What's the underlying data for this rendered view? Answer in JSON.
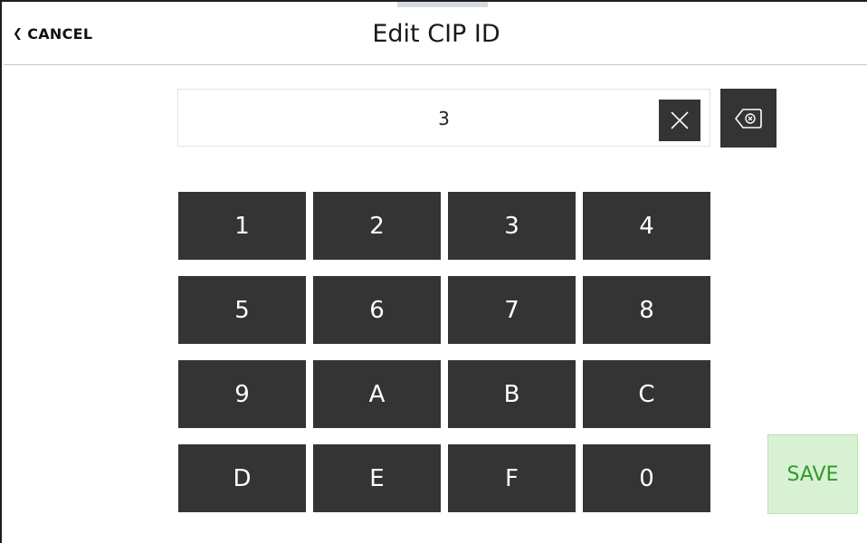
{
  "header": {
    "cancel_label": "CANCEL",
    "title": "Edit CIP ID"
  },
  "entry": {
    "value": "3"
  },
  "keypad": {
    "keys": [
      "1",
      "2",
      "3",
      "4",
      "5",
      "6",
      "7",
      "8",
      "9",
      "A",
      "B",
      "C",
      "D",
      "E",
      "F",
      "0"
    ]
  },
  "actions": {
    "save_label": "SAVE"
  },
  "icons": {
    "cancel": "chevron-left-icon",
    "clear": "close-icon",
    "backspace": "backspace-icon"
  },
  "colors": {
    "key_background": "#343434",
    "key_text": "#ffffff",
    "save_background": "#d8f1d2",
    "save_text": "#2f9a2a"
  }
}
